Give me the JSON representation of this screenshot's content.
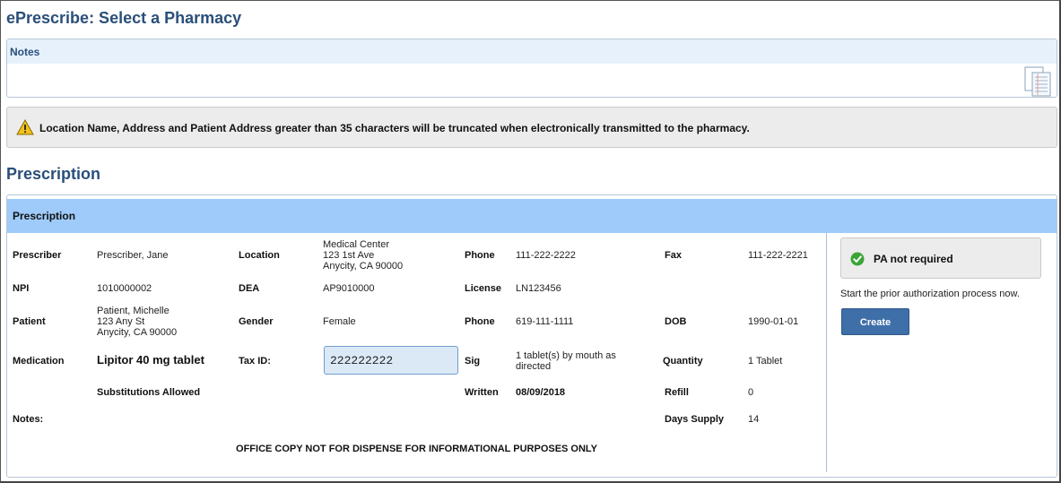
{
  "page": {
    "title": "ePrescribe: Select a Pharmacy"
  },
  "notes": {
    "header": "Notes",
    "icon": "notes-document-icon"
  },
  "warning": {
    "icon": "warning-icon",
    "text": "Location Name, Address and Patient Address greater than 35 characters will be truncated when electronically transmitted to the pharmacy."
  },
  "prescription": {
    "section_title": "Prescription",
    "panel_header": "Prescription",
    "prescriber_label": "Prescriber",
    "prescriber_value": "Prescriber, Jane",
    "location_label": "Location",
    "location_value": "Medical Center\n123 1st Ave\nAnycity, CA 90000",
    "phone1_label": "Phone",
    "phone1_value": "111-222-2222",
    "fax_label": "Fax",
    "fax_value": "111-222-2221",
    "npi_label": "NPI",
    "npi_value": "1010000002",
    "dea_label": "DEA",
    "dea_value": "AP9010000",
    "license_label": "License",
    "license_value": "LN123456",
    "patient_label": "Patient",
    "patient_value": "Patient, Michelle\n123 Any St\nAnycity, CA 90000",
    "gender_label": "Gender",
    "gender_value": "Female",
    "phone2_label": "Phone",
    "phone2_value": "619-111-1111",
    "dob_label": "DOB",
    "dob_value": "1990-01-01",
    "medication_label": "Medication",
    "medication_value": "Lipitor 40 mg tablet",
    "taxid_label": "Tax ID:",
    "taxid_value": "222222222",
    "sig_label": "Sig",
    "sig_value": "1 tablet(s) by mouth as\ndirected",
    "quantity_label": "Quantity",
    "quantity_value": "1 Tablet",
    "substitutions": "Substitutions Allowed",
    "written_label": "Written",
    "written_value": "08/09/2018",
    "refill_label": "Refill",
    "refill_value": "0",
    "notes_label": "Notes:",
    "days_supply_label": "Days Supply",
    "days_supply_value": "14",
    "footer": "OFFICE COPY NOT FOR DISPENSE FOR INFORMATIONAL PURPOSES ONLY"
  },
  "prior_auth": {
    "icon": "check-circle-icon",
    "status": "PA not required",
    "note": "Start the prior authorization process now.",
    "button_label": "Create"
  },
  "colors": {
    "title": "#2a4f7a",
    "notes_header_bg": "#e6f1fc",
    "panel_header_bg": "#9ecbfa",
    "button_bg": "#3e6fa8",
    "success_green": "#3aa536",
    "warning_yellow": "#f2c21b"
  }
}
